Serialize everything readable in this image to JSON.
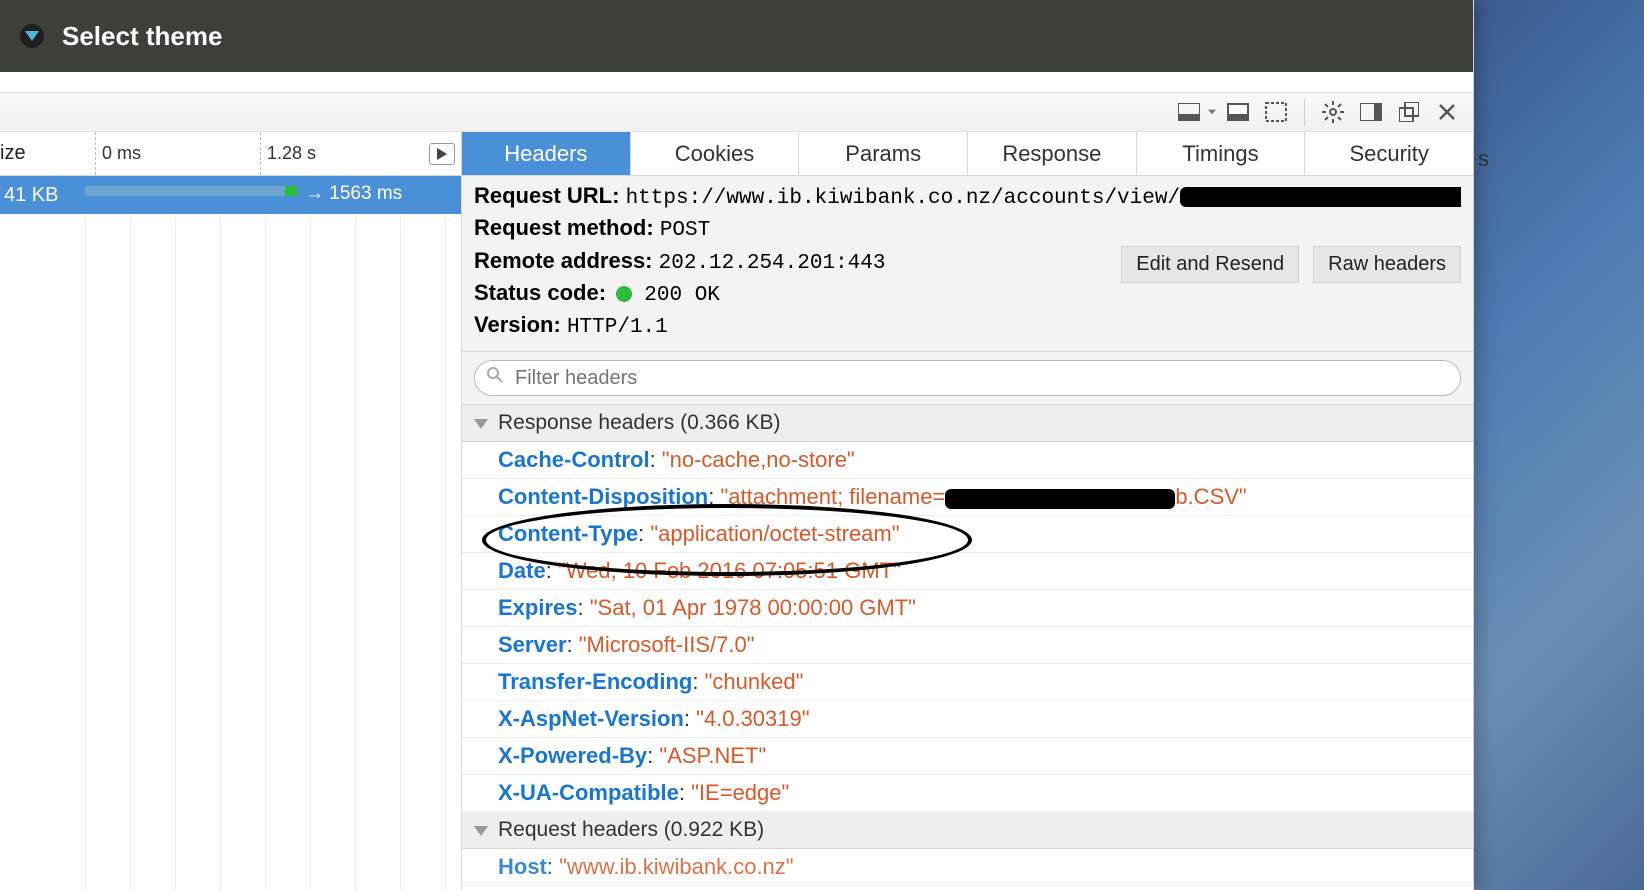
{
  "banner": {
    "label": "Select theme"
  },
  "timeline": {
    "size_col_label": "ize",
    "tick0": "0 ms",
    "tick1": "1.28 s",
    "selected": {
      "size": "41 KB",
      "ms": "→ 1563 ms"
    }
  },
  "tabs": [
    "Headers",
    "Cookies",
    "Params",
    "Response",
    "Timings",
    "Security"
  ],
  "summary": {
    "request_url_k": "Request URL:",
    "request_url_v": "https://www.ib.kiwibank.co.nz/accounts/view/",
    "request_method_k": "Request method:",
    "request_method_v": "POST",
    "remote_addr_k": "Remote address:",
    "remote_addr_v": "202.12.254.201:443",
    "status_code_k": "Status code:",
    "status_code_v": "200 OK",
    "version_k": "Version:",
    "version_v": "HTTP/1.1",
    "btn_edit": "Edit and Resend",
    "btn_raw": "Raw headers"
  },
  "filter": {
    "placeholder": "Filter headers"
  },
  "sections": {
    "response": "Response headers (0.366 KB)",
    "request": "Request headers (0.922 KB)"
  },
  "response_headers": [
    {
      "name": "Cache-Control",
      "value": "\"no-cache,no-store\""
    },
    {
      "name": "Content-Disposition",
      "value_pre": "\"attachment; filename=",
      "redacted": true,
      "value_post": "b.CSV\""
    },
    {
      "name": "Content-Type",
      "value": "\"application/octet-stream\""
    },
    {
      "name": "Date",
      "value": "\"Wed, 10 Feb 2016 07:05:51 GMT\""
    },
    {
      "name": "Expires",
      "value": "\"Sat, 01 Apr 1978 00:00:00 GMT\""
    },
    {
      "name": "Server",
      "value": "\"Microsoft-IIS/7.0\""
    },
    {
      "name": "Transfer-Encoding",
      "value": "\"chunked\""
    },
    {
      "name": "X-AspNet-Version",
      "value": "\"4.0.30319\""
    },
    {
      "name": "X-Powered-By",
      "value": "\"ASP.NET\""
    },
    {
      "name": "X-UA-Compatible",
      "value": "\"IE=edge\""
    }
  ],
  "request_headers_first": {
    "name": "Host",
    "value": "\"www.ib.kiwibank.co.nz\""
  },
  "desktop_letter": "s"
}
